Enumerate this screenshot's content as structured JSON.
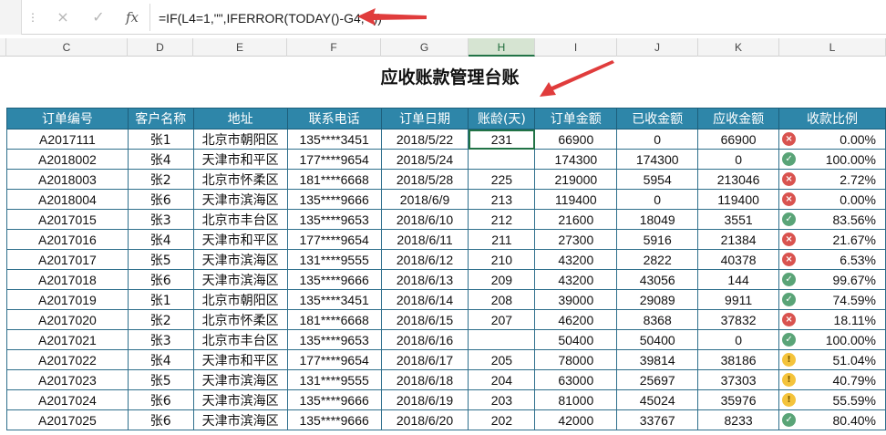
{
  "formula_bar": {
    "cancel_icon": "×",
    "enter_icon": "✓",
    "fx_label": "fx",
    "formula": "=IF(L4=1,\"\",IFERROR(TODAY()-G4,\"\"))"
  },
  "columns": [
    "C",
    "D",
    "E",
    "F",
    "G",
    "H",
    "I",
    "J",
    "K",
    "L"
  ],
  "active_column": "H",
  "sheet": {
    "title": "应收账款管理台账",
    "headers": [
      "订单编号",
      "客户名称",
      "地址",
      "联系电话",
      "订单日期",
      "账龄(天)",
      "订单金额",
      "已收金额",
      "应收金额",
      "收款比例"
    ],
    "rows": [
      {
        "id": "A2017111",
        "client": "张1",
        "addr": "北京市朝阳区",
        "phone": "135****3451",
        "date": "2018/5/22",
        "age": "231",
        "amount": "66900",
        "received": "0",
        "due": "66900",
        "status": "bad",
        "ratio": "0.00%"
      },
      {
        "id": "A2018002",
        "client": "张4",
        "addr": "天津市和平区",
        "phone": "177****9654",
        "date": "2018/5/24",
        "age": "",
        "amount": "174300",
        "received": "174300",
        "due": "0",
        "status": "good",
        "ratio": "100.00%"
      },
      {
        "id": "A2018003",
        "client": "张2",
        "addr": "北京市怀柔区",
        "phone": "181****6668",
        "date": "2018/5/28",
        "age": "225",
        "amount": "219000",
        "received": "5954",
        "due": "213046",
        "status": "bad",
        "ratio": "2.72%"
      },
      {
        "id": "A2018004",
        "client": "张6",
        "addr": "天津市滨海区",
        "phone": "135****9666",
        "date": "2018/6/9",
        "age": "213",
        "amount": "119400",
        "received": "0",
        "due": "119400",
        "status": "bad",
        "ratio": "0.00%"
      },
      {
        "id": "A2017015",
        "client": "张3",
        "addr": "北京市丰台区",
        "phone": "135****9653",
        "date": "2018/6/10",
        "age": "212",
        "amount": "21600",
        "received": "18049",
        "due": "3551",
        "status": "good",
        "ratio": "83.56%"
      },
      {
        "id": "A2017016",
        "client": "张4",
        "addr": "天津市和平区",
        "phone": "177****9654",
        "date": "2018/6/11",
        "age": "211",
        "amount": "27300",
        "received": "5916",
        "due": "21384",
        "status": "bad",
        "ratio": "21.67%"
      },
      {
        "id": "A2017017",
        "client": "张5",
        "addr": "天津市滨海区",
        "phone": "131****9555",
        "date": "2018/6/12",
        "age": "210",
        "amount": "43200",
        "received": "2822",
        "due": "40378",
        "status": "bad",
        "ratio": "6.53%"
      },
      {
        "id": "A2017018",
        "client": "张6",
        "addr": "天津市滨海区",
        "phone": "135****9666",
        "date": "2018/6/13",
        "age": "209",
        "amount": "43200",
        "received": "43056",
        "due": "144",
        "status": "good",
        "ratio": "99.67%"
      },
      {
        "id": "A2017019",
        "client": "张1",
        "addr": "北京市朝阳区",
        "phone": "135****3451",
        "date": "2018/6/14",
        "age": "208",
        "amount": "39000",
        "received": "29089",
        "due": "9911",
        "status": "good",
        "ratio": "74.59%"
      },
      {
        "id": "A2017020",
        "client": "张2",
        "addr": "北京市怀柔区",
        "phone": "181****6668",
        "date": "2018/6/15",
        "age": "207",
        "amount": "46200",
        "received": "8368",
        "due": "37832",
        "status": "bad",
        "ratio": "18.11%"
      },
      {
        "id": "A2017021",
        "client": "张3",
        "addr": "北京市丰台区",
        "phone": "135****9653",
        "date": "2018/6/16",
        "age": "",
        "amount": "50400",
        "received": "50400",
        "due": "0",
        "status": "good",
        "ratio": "100.00%"
      },
      {
        "id": "A2017022",
        "client": "张4",
        "addr": "天津市和平区",
        "phone": "177****9654",
        "date": "2018/6/17",
        "age": "205",
        "amount": "78000",
        "received": "39814",
        "due": "38186",
        "status": "warn",
        "ratio": "51.04%"
      },
      {
        "id": "A2017023",
        "client": "张5",
        "addr": "天津市滨海区",
        "phone": "131****9555",
        "date": "2018/6/18",
        "age": "204",
        "amount": "63000",
        "received": "25697",
        "due": "37303",
        "status": "warn",
        "ratio": "40.79%"
      },
      {
        "id": "A2017024",
        "client": "张6",
        "addr": "天津市滨海区",
        "phone": "135****9666",
        "date": "2018/6/19",
        "age": "203",
        "amount": "81000",
        "received": "45024",
        "due": "35976",
        "status": "warn",
        "ratio": "55.59%"
      },
      {
        "id": "A2017025",
        "client": "张6",
        "addr": "天津市滨海区",
        "phone": "135****9666",
        "date": "2018/6/20",
        "age": "202",
        "amount": "42000",
        "received": "33767",
        "due": "8233",
        "status": "good",
        "ratio": "80.40%"
      }
    ]
  },
  "status_icons": {
    "bad": "×",
    "good": "✓",
    "warn": "!"
  },
  "colors": {
    "header_bg": "#2e86a9",
    "grid": "#2e6f8c",
    "arrow": "#e03c3c",
    "selection": "#217346"
  }
}
